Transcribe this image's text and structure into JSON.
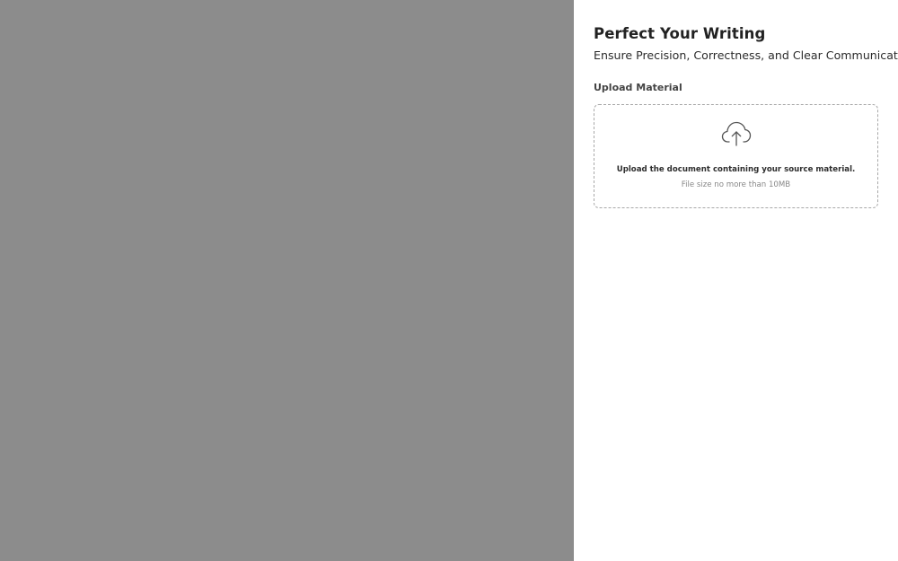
{
  "panel": {
    "title": "Perfect Your Writing",
    "subtitle": "Ensure Precision, Correctness, and Clear Communication",
    "upload_label": "Upload Material",
    "dropzone": {
      "icon": "cloud-upload-icon",
      "primary_text": "Upload the document containing your source material.",
      "secondary_text": "File size no more than 10MB"
    }
  },
  "colors": {
    "overlay": "#8c8c8c",
    "panel_background": "#ffffff",
    "title": "#222222",
    "secondary_text": "#888888",
    "dropzone_border": "#a8a8a8"
  }
}
